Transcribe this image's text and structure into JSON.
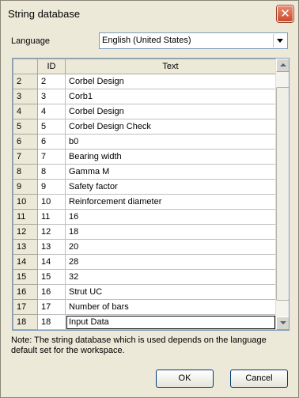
{
  "window": {
    "title": "String database",
    "close_glyph": "✕"
  },
  "language": {
    "label": "Language",
    "selected": "English (United States)"
  },
  "grid": {
    "columns": [
      "",
      "ID",
      "Text"
    ],
    "rows": [
      {
        "row": "2",
        "id": "2",
        "text": "Corbel Design"
      },
      {
        "row": "3",
        "id": "3",
        "text": "Corb1"
      },
      {
        "row": "4",
        "id": "4",
        "text": "Corbel Design"
      },
      {
        "row": "5",
        "id": "5",
        "text": "Corbel Design Check"
      },
      {
        "row": "6",
        "id": "6",
        "text": "b0"
      },
      {
        "row": "7",
        "id": "7",
        "text": "Bearing width"
      },
      {
        "row": "8",
        "id": "8",
        "text": "Gamma M"
      },
      {
        "row": "9",
        "id": "9",
        "text": "Safety factor"
      },
      {
        "row": "10",
        "id": "10",
        "text": "Reinforcement diameter"
      },
      {
        "row": "11",
        "id": "11",
        "text": "16"
      },
      {
        "row": "12",
        "id": "12",
        "text": "18"
      },
      {
        "row": "13",
        "id": "13",
        "text": "20"
      },
      {
        "row": "14",
        "id": "14",
        "text": "28"
      },
      {
        "row": "15",
        "id": "15",
        "text": "32"
      },
      {
        "row": "16",
        "id": "16",
        "text": "Strut UC"
      },
      {
        "row": "17",
        "id": "17",
        "text": "Number of bars"
      },
      {
        "row": "18",
        "id": "18",
        "text": "Input Data"
      }
    ],
    "selected_row": "18"
  },
  "note": "Note: The string database which is used depends on the language default set for the workspace.",
  "buttons": {
    "ok": "OK",
    "cancel": "Cancel"
  }
}
